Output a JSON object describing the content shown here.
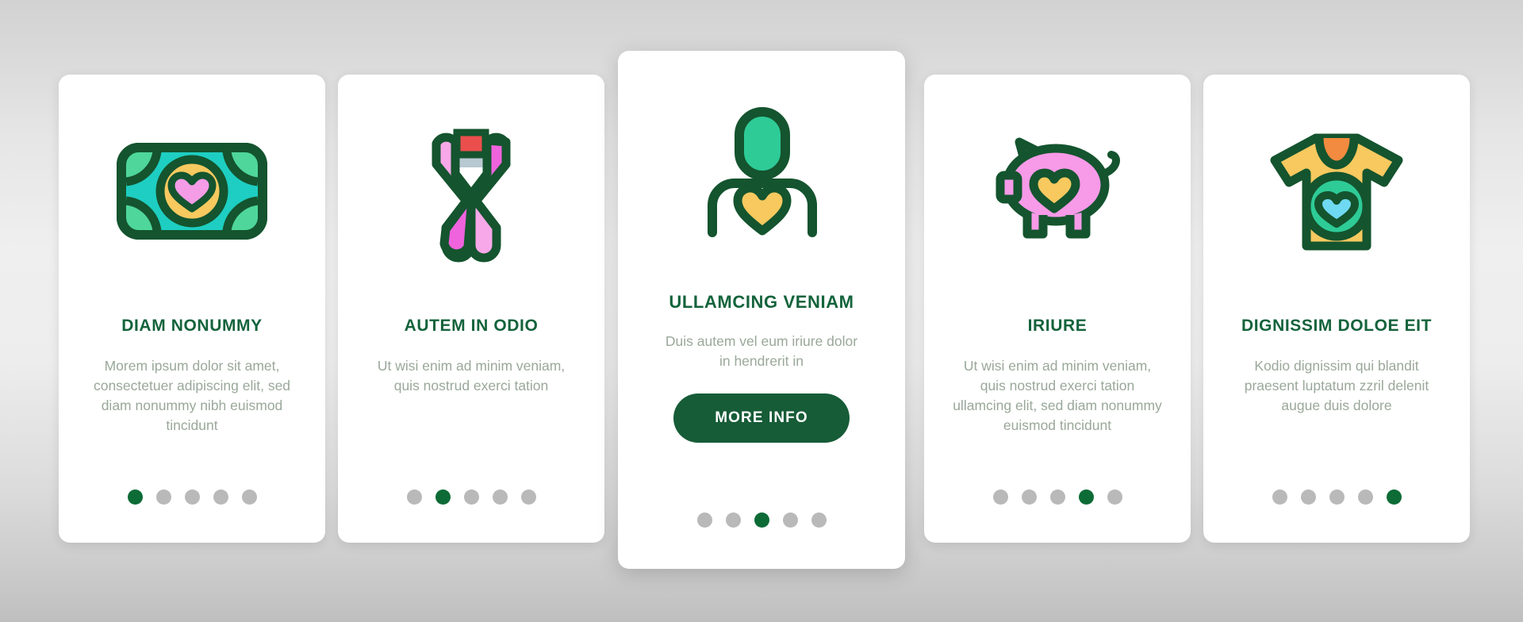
{
  "theme": {
    "brand_green": "#14633c",
    "button_green": "#165c37",
    "body_text_gray": "#9aa89a",
    "dot_inactive": "#b9b9b9",
    "dot_active": "#0d6b36",
    "card_background": "#ffffff",
    "page_background": "#e3e3e3"
  },
  "cards": [
    {
      "icon": "money-bill-heart-icon",
      "title": "DIAM NONUMMY",
      "body": "Morem ipsum dolor sit amet, consectetuer adipiscing elit, sed diam nonummy nibh euismod tincidunt",
      "dots": {
        "count": 5,
        "active_index": 1
      },
      "featured": false
    },
    {
      "icon": "awareness-ribbon-icon",
      "title": "AUTEM IN ODIO",
      "body": "Ut wisi enim ad minim veniam, quis nostrud exerci tation",
      "dots": {
        "count": 5,
        "active_index": 2
      },
      "featured": false
    },
    {
      "icon": "person-heart-icon",
      "title": "ULLAMCING VENIAM",
      "body": "Duis autem vel eum iriure dolor in hendrerit in",
      "button_label": "MORE INFO",
      "dots": {
        "count": 5,
        "active_index": 3
      },
      "featured": true
    },
    {
      "icon": "piggy-bank-heart-icon",
      "title": "IRIURE",
      "body": "Ut wisi enim ad minim veniam, quis nostrud exerci tation ullamcing elit, sed diam nonummy euismod tincidunt",
      "dots": {
        "count": 5,
        "active_index": 4
      },
      "featured": false
    },
    {
      "icon": "tshirt-heart-icon",
      "title": "DIGNISSIM DOLOE EIT",
      "body": "Kodio dignissim qui blandit praesent luptatum zzril delenit augue duis dolore",
      "dots": {
        "count": 5,
        "active_index": 5
      },
      "featured": false
    }
  ]
}
